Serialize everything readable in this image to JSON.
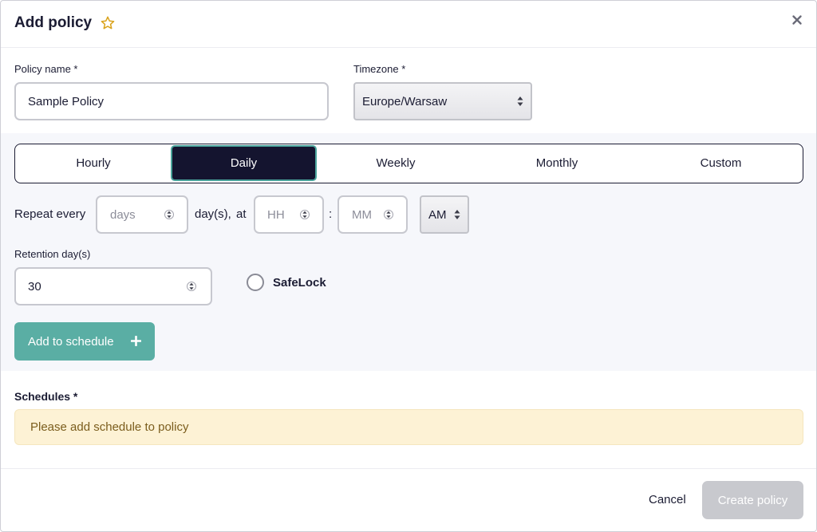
{
  "dialog": {
    "title": "Add policy"
  },
  "form": {
    "policy_name_label": "Policy name *",
    "policy_name_value": "Sample Policy",
    "timezone_label": "Timezone *",
    "timezone_value": "Europe/Warsaw"
  },
  "tabs": [
    {
      "label": "Hourly",
      "active": false
    },
    {
      "label": "Daily",
      "active": true
    },
    {
      "label": "Weekly",
      "active": false
    },
    {
      "label": "Monthly",
      "active": false
    },
    {
      "label": "Custom",
      "active": false
    }
  ],
  "repeat": {
    "prefix": "Repeat every",
    "days_placeholder": "days",
    "suffix": "day(s),",
    "at": "at",
    "hour_placeholder": "HH",
    "colon": ":",
    "minute_placeholder": "MM",
    "ampm_value": "AM"
  },
  "retention": {
    "label": "Retention day(s)",
    "value": "30"
  },
  "safelock": {
    "label": "SafeLock",
    "checked": false
  },
  "add_schedule_label": "Add to schedule",
  "schedules": {
    "title": "Schedules *",
    "empty_notice": "Please add schedule to policy"
  },
  "footer": {
    "cancel_label": "Cancel",
    "create_label": "Create policy"
  },
  "colors": {
    "active_tab_bg": "#14142f",
    "accent_teal": "#5aaea4",
    "notice_bg": "#fdf2d5",
    "star": "#d9a21b",
    "disabled_btn": "#c8c9ce"
  }
}
